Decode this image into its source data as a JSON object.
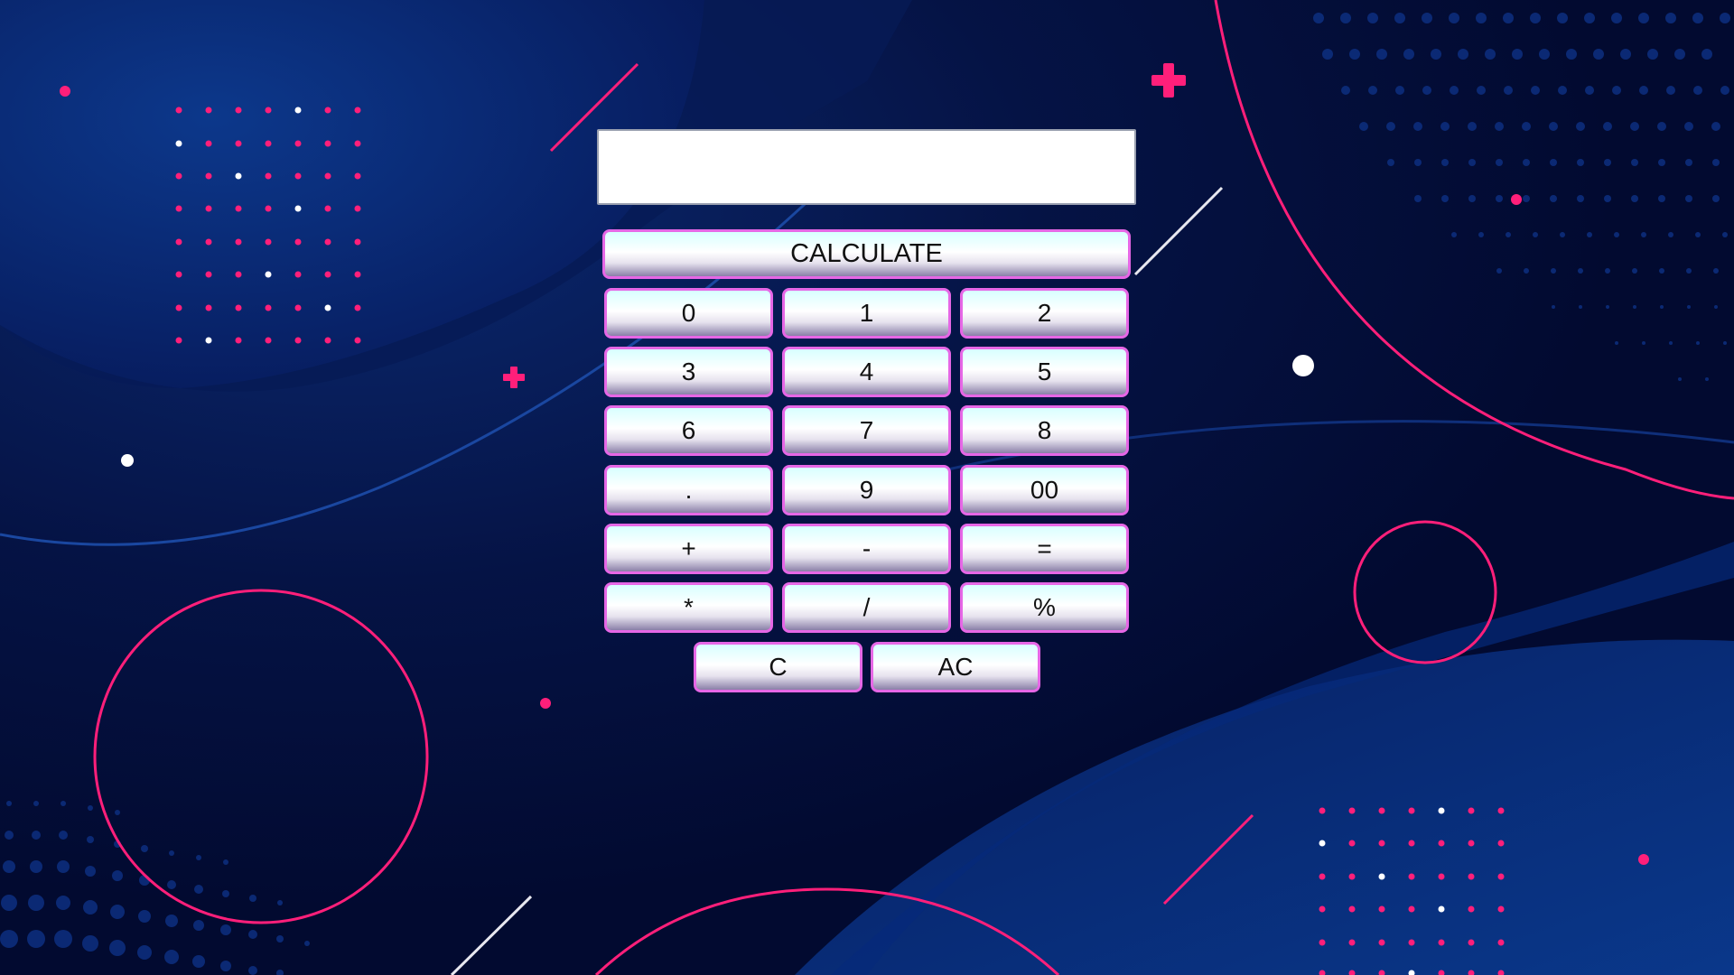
{
  "display": {
    "value": "",
    "placeholder": ""
  },
  "buttons": {
    "calculate": "CALCULATE",
    "rows": [
      [
        "0",
        "1",
        "2"
      ],
      [
        "3",
        "4",
        "5"
      ],
      [
        "6",
        "7",
        "8"
      ],
      [
        ".",
        "9",
        "00"
      ],
      [
        "+",
        "-",
        "="
      ],
      [
        "*",
        "/",
        "%"
      ]
    ],
    "clear": "C",
    "all_clear": "AC"
  },
  "colors": {
    "background": "#020a30",
    "accent_pink": "#ff1f7a",
    "button_border": "#e667e6"
  }
}
